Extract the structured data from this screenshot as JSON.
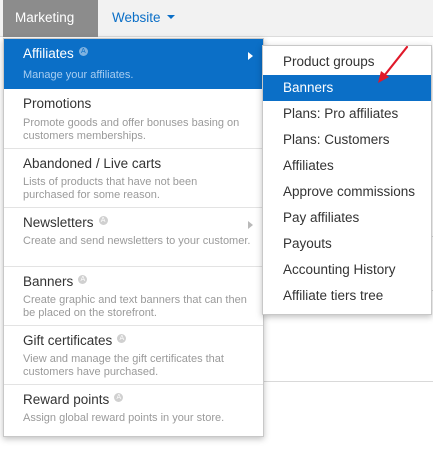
{
  "colors": {
    "accent": "#0b6fc7",
    "annotation_arrow": "#e0192a"
  },
  "topbar": {
    "tabs": [
      {
        "label": "Marketing",
        "active": true
      },
      {
        "label": "Website",
        "active": false
      }
    ]
  },
  "menu": {
    "items": [
      {
        "title": "Affiliates",
        "desc": "Manage your affiliates.",
        "badge": "A",
        "has_submenu": true,
        "active": true
      },
      {
        "title": "Promotions",
        "desc": "Promote goods and offer bonuses basing on customers memberships.",
        "has_submenu": false
      },
      {
        "title": "Abandoned / Live carts",
        "desc": "Lists of products that have not been purchased for some reason.",
        "has_submenu": false
      },
      {
        "title": "Newsletters",
        "desc": "Create and send newsletters to your customer.",
        "badge": "A",
        "has_submenu": true
      },
      {
        "title": "Banners",
        "desc": "Create graphic and text banners that can then be placed on the storefront.",
        "badge": "A",
        "has_submenu": false
      },
      {
        "title": "Gift certificates",
        "desc": "View and manage the gift certificates that customers have purchased.",
        "badge": "A",
        "has_submenu": false
      },
      {
        "title": "Reward points",
        "desc": "Assign global reward points in your store.",
        "badge": "A",
        "has_submenu": false
      }
    ]
  },
  "submenu": {
    "items": [
      {
        "label": "Product groups"
      },
      {
        "label": "Banners",
        "active": true
      },
      {
        "label": "Plans: Pro affiliates"
      },
      {
        "label": "Plans: Customers"
      },
      {
        "label": "Affiliates"
      },
      {
        "label": "Approve commissions"
      },
      {
        "label": "Pay affiliates"
      },
      {
        "label": "Payouts"
      },
      {
        "label": "Accounting History"
      },
      {
        "label": "Affiliate tiers tree"
      }
    ]
  }
}
